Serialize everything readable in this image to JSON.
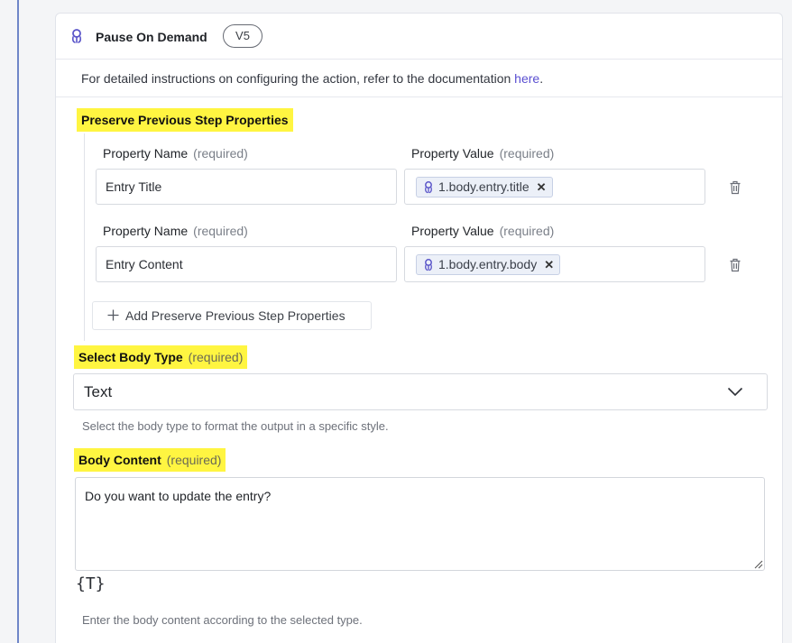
{
  "header": {
    "title": "Pause On Demand",
    "version": "V5",
    "icon": "app-logo-icon"
  },
  "doc": {
    "prefix": "For detailed instructions on configuring the action, refer to the documentation",
    "link": "here",
    "suffix": "."
  },
  "preserve": {
    "section_label": "Preserve Previous Step Properties",
    "name_label": "Property Name",
    "value_label": "Property Value",
    "required": "(required)",
    "rows": [
      {
        "name": "Entry Title",
        "value": "1.body.entry.title"
      },
      {
        "name": "Entry Content",
        "value": "1.body.entry.body"
      }
    ],
    "add_label": "Add Preserve Previous Step Properties"
  },
  "body_type": {
    "label": "Select Body Type",
    "required": "(required)",
    "selected": "Text",
    "help": "Select the body type to format the output in a specific style."
  },
  "body_content": {
    "label": "Body Content",
    "required": "(required)",
    "value": "Do you want to update the entry?",
    "template_icon": "{T}",
    "help": "Enter the body content according to the selected type."
  },
  "colors": {
    "highlight": "#fff541",
    "link": "#5a4fd1",
    "accent": "#6f86c8"
  }
}
